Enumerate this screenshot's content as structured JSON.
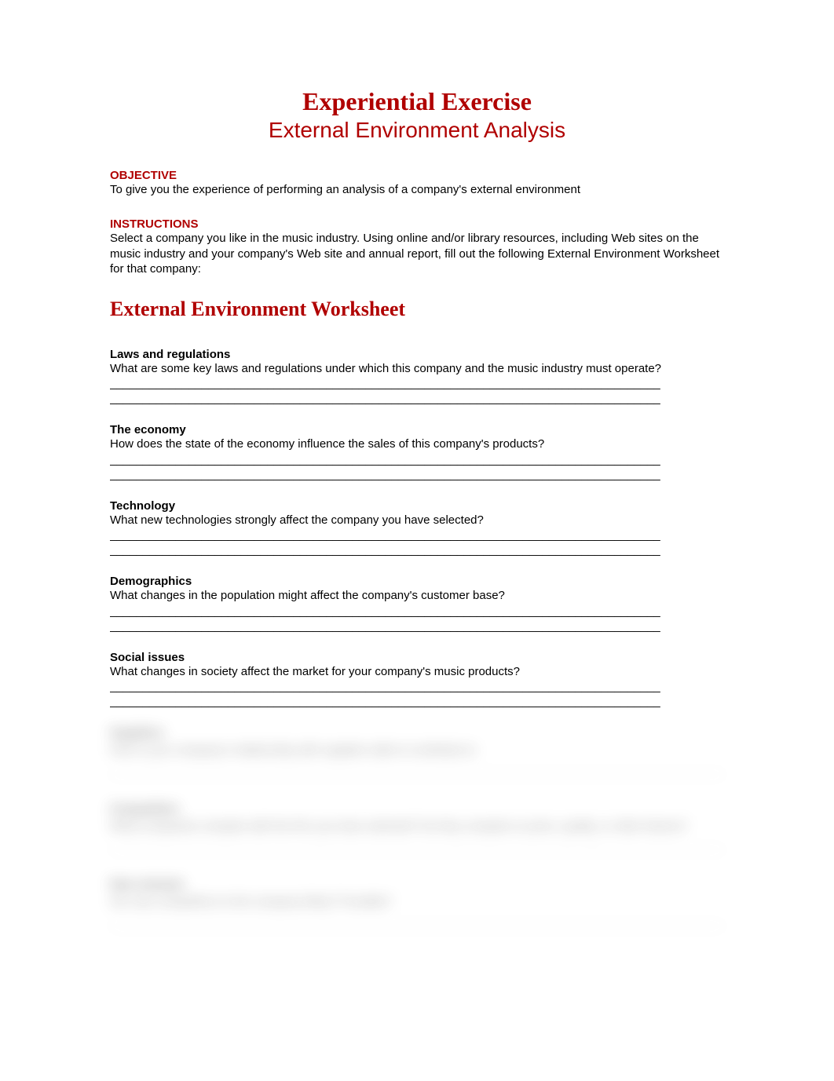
{
  "header": {
    "title_main": "Experiential Exercise",
    "title_sub": "External Environment Analysis"
  },
  "objective": {
    "label": "OBJECTIVE",
    "text": "To give you the experience of performing an analysis of a company's external environment"
  },
  "instructions": {
    "label": "INSTRUCTIONS",
    "text": "Select a company you like in the music industry. Using online and/or library resources, including Web sites on the music industry and your company's Web site and annual report, fill out the following External Environment Worksheet for that company:"
  },
  "worksheet_title": "External Environment Worksheet",
  "sections": [
    {
      "heading": "Laws and regulations",
      "question": "What are some key laws and regulations under which this company and the music industry must operate?"
    },
    {
      "heading": "The economy",
      "question": "How does the state of the economy influence the sales of this company's products?"
    },
    {
      "heading": "Technology",
      "question": "What new technologies strongly affect the company you have selected?"
    },
    {
      "heading": "Demographics",
      "question": "What changes in the population might affect the company's customer base?"
    },
    {
      "heading": "Social issues",
      "question": "What changes in society affect the market for your company's music products?"
    }
  ],
  "blurred": [
    {
      "heading": "Suppliers",
      "text": "How is your company's relationship with suppliers able to contribute to"
    },
    {
      "heading": "Competition",
      "text": "What companies compete with the firm you have selected? Do they compete on price, quality, or other factors?"
    },
    {
      "heading": "New entrants",
      "text": "Are new competitors to the company likely? Possible?"
    }
  ],
  "line": "____________________________________________________________________________________"
}
